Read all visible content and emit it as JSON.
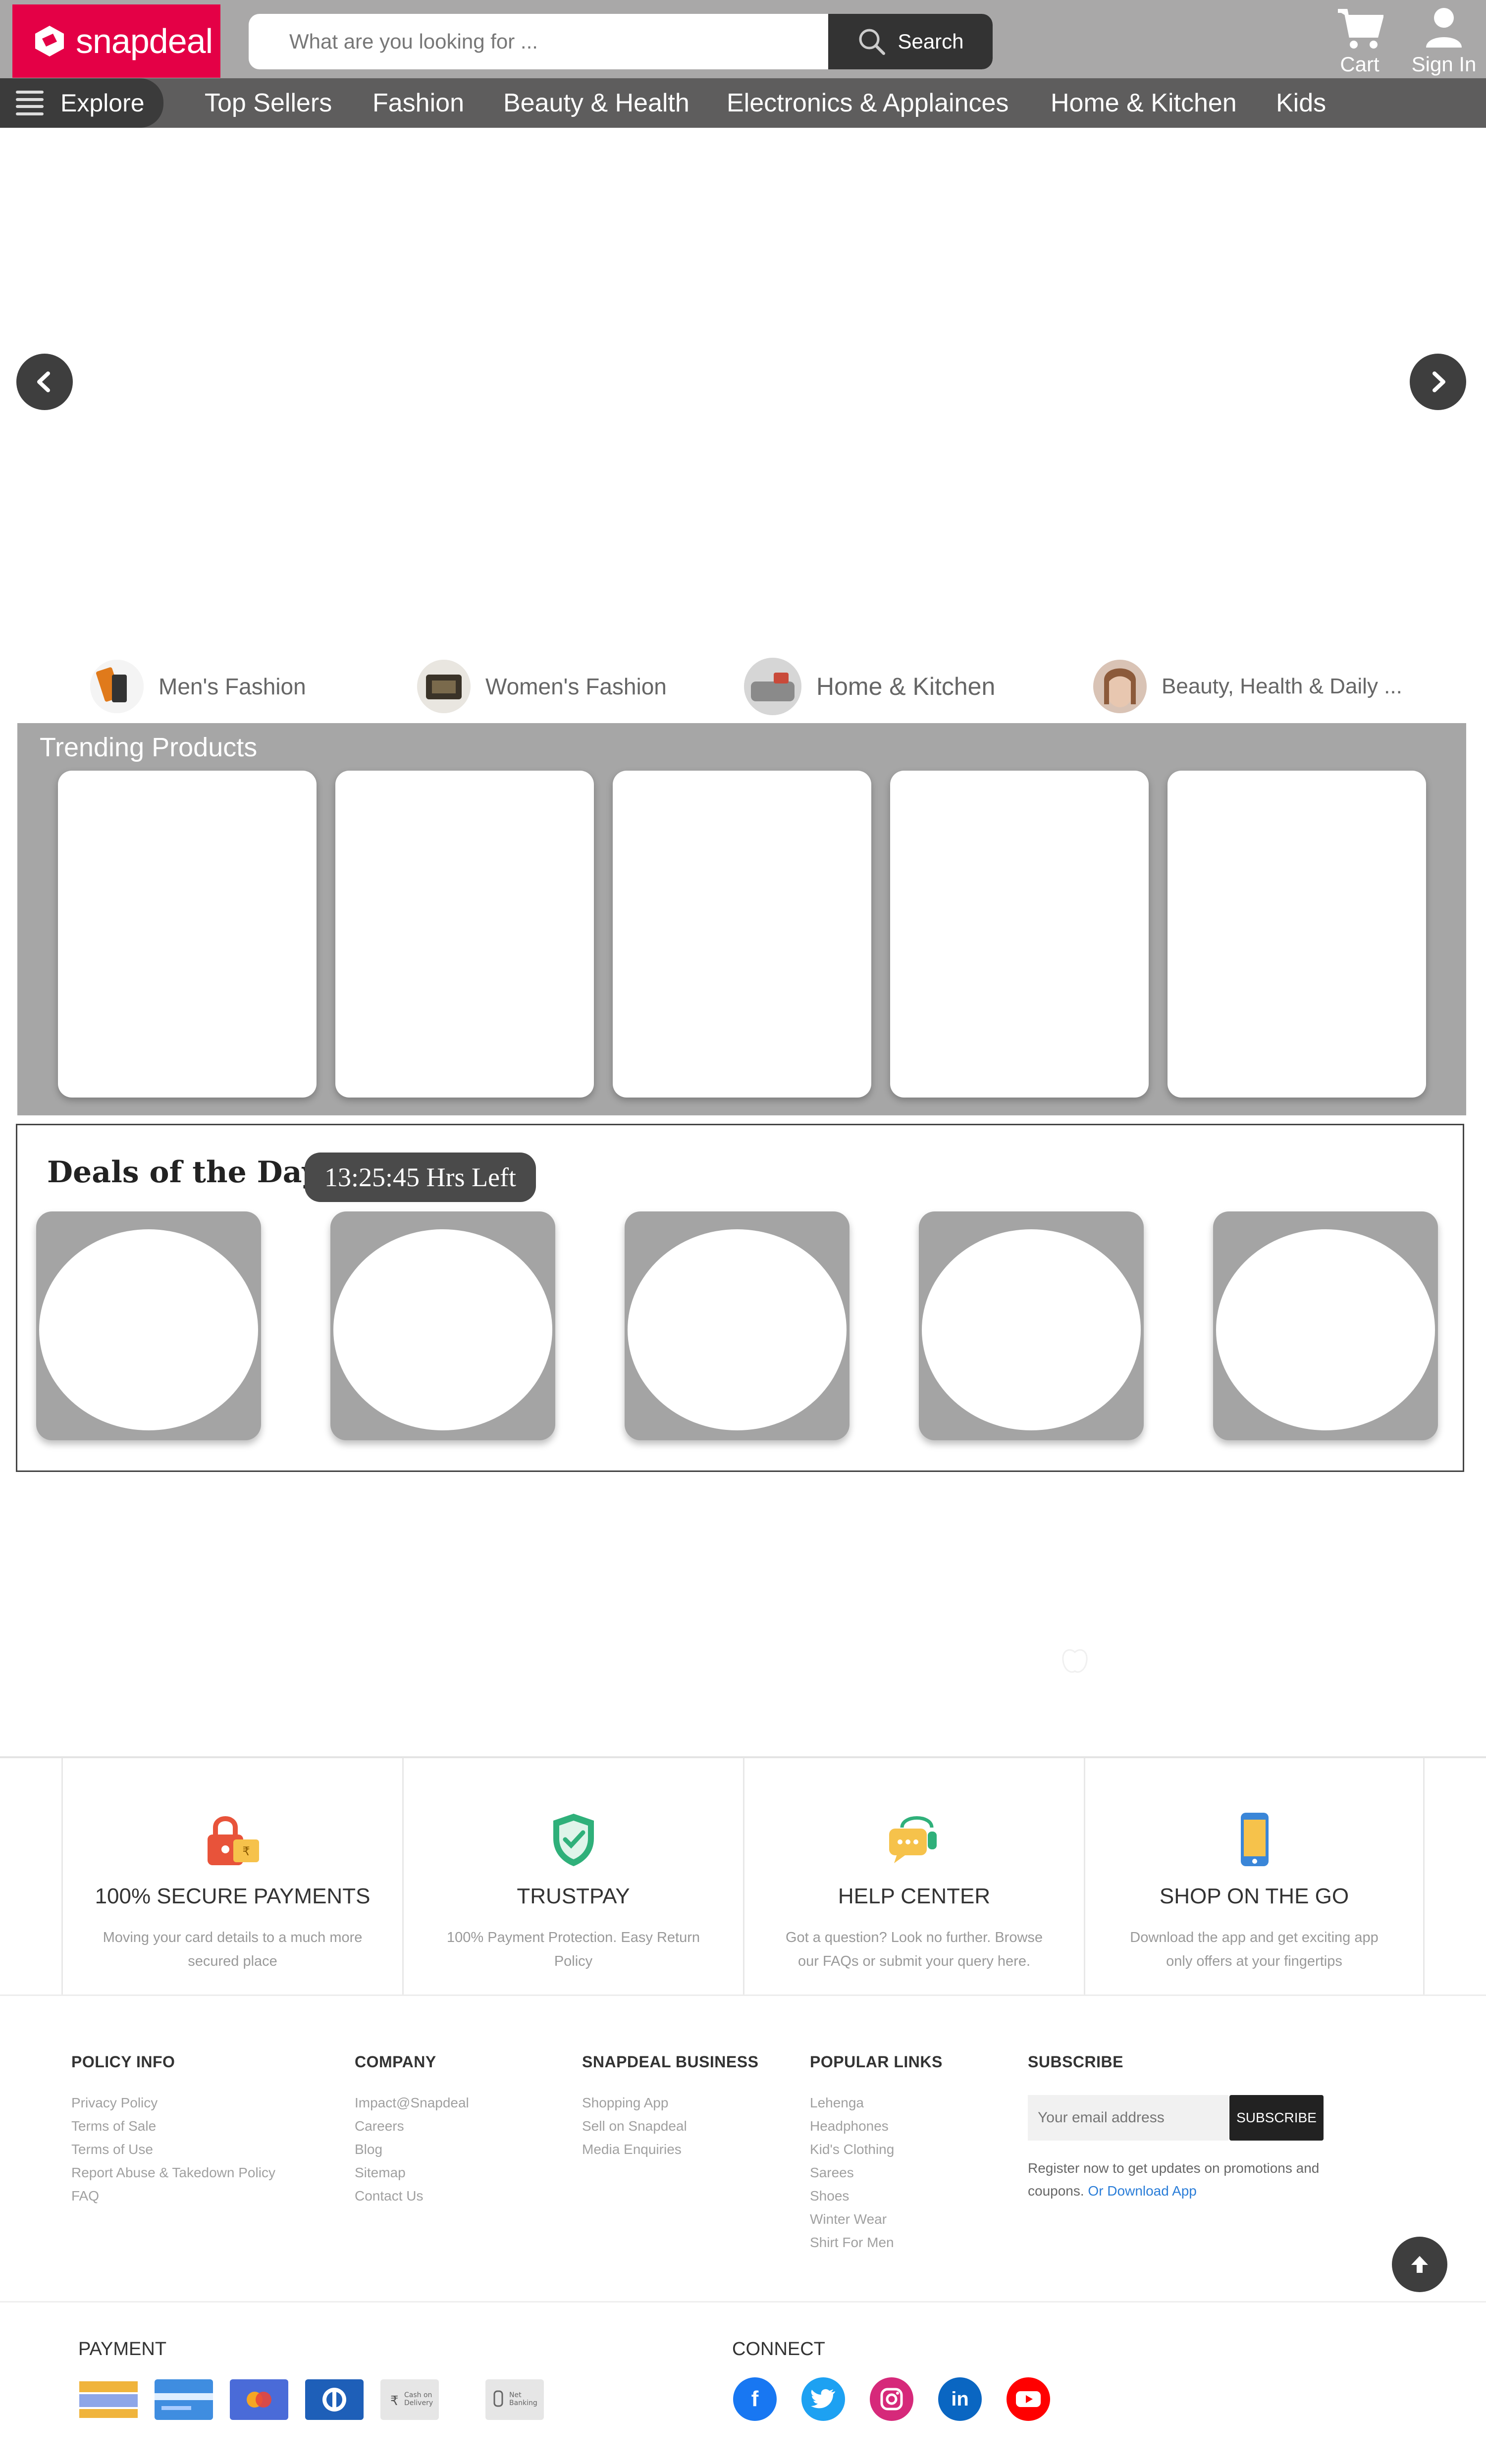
{
  "header": {
    "brand": "snapdeal",
    "search_placeholder": "What are you looking for ...",
    "search_button": "Search",
    "cart_label": "Cart",
    "signin_label": "Sign In"
  },
  "nav": {
    "explore": "Explore",
    "items": [
      "Top Sellers",
      "Fashion",
      "Beauty & Health",
      "Electronics & Applainces",
      "Home & Kitchen",
      "Kids"
    ]
  },
  "categories": [
    "Men's Fashion",
    "Women's Fashion",
    "Home & Kitchen",
    "Beauty, Health & Daily ..."
  ],
  "trending": {
    "title": "Trending Products"
  },
  "deals": {
    "title": "Deals of the Day",
    "timer": "13:25:45 Hrs Left"
  },
  "features": [
    {
      "title": "100% SECURE PAYMENTS",
      "desc": "Moving your card details to a much more secured place",
      "icon": "lock-icon"
    },
    {
      "title": "TRUSTPAY",
      "desc": "100% Payment Protection. Easy Return Policy",
      "icon": "shield-check-icon"
    },
    {
      "title": "HELP CENTER",
      "desc": "Got a question? Look no further. Browse our FAQs or submit your query here.",
      "icon": "chat-headset-icon"
    },
    {
      "title": "SHOP ON THE GO",
      "desc": "Download the app and get exciting app only offers at your fingertips",
      "icon": "mobile-icon"
    }
  ],
  "footer": {
    "policy": {
      "head": "POLICY INFO",
      "links": [
        "Privacy Policy",
        "Terms of Sale",
        "Terms of Use",
        "Report Abuse & Takedown Policy",
        "FAQ"
      ]
    },
    "company": {
      "head": "COMPANY",
      "links": [
        "Impact@Snapdeal",
        "Careers",
        "Blog",
        "Sitemap",
        "Contact Us"
      ]
    },
    "business": {
      "head": "SNAPDEAL BUSINESS",
      "links": [
        "Shopping App",
        "Sell on Snapdeal",
        "Media Enquiries"
      ]
    },
    "popular": {
      "head": "POPULAR LINKS",
      "links": [
        "Lehenga",
        "Headphones",
        "Kid's Clothing",
        "Sarees",
        "Shoes",
        "Winter Wear",
        "Shirt For Men"
      ]
    },
    "subscribe": {
      "head": "SUBSCRIBE",
      "placeholder": "Your email address",
      "button": "SUBSCRIBE",
      "note": "Register now to get updates on promotions and coupons.",
      "note_link": "Or Download App"
    },
    "payment_head": "PAYMENT",
    "connect_head": "CONNECT",
    "payment_icons": [
      "visa-card-icon",
      "master-card-icon",
      "maestro-icon",
      "diners-icon",
      "cash-on-delivery-icon",
      "net-banking-icon"
    ],
    "payment_labels": {
      "cod": "Cash on Delivery",
      "netbanking": "Net Banking"
    },
    "social_icons": [
      "facebook-icon",
      "twitter-icon",
      "instagram-icon",
      "linkedin-icon",
      "youtube-icon"
    ]
  },
  "colors": {
    "brand": "#e40046",
    "header_bg": "#a9a8a8",
    "nav_bg": "#5e5d5d",
    "link_blue": "#2a7dd8"
  }
}
